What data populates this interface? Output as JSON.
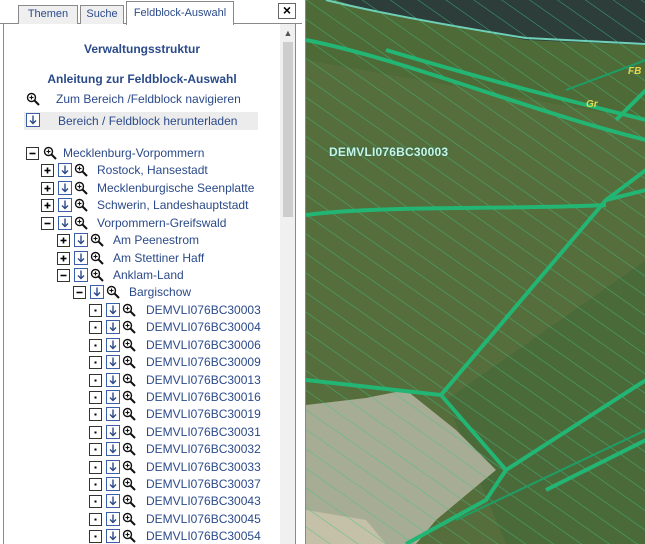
{
  "tabs": [
    {
      "label": "Themen",
      "active": false
    },
    {
      "label": "Suche",
      "active": false
    },
    {
      "label": "Feldblock-Auswahl",
      "active": true
    }
  ],
  "close_label": "×",
  "heading": "Verwaltungsstruktur",
  "anleitung": "Anleitung zur Feldblock-Auswahl",
  "actions": {
    "navigate": "Zum Bereich /Feldblock navigieren",
    "download": "Bereich / Feldblock herunterladen"
  },
  "tree": {
    "root": "Mecklenburg-Vorpommern",
    "districts": [
      "Rostock, Hansestadt",
      "Mecklenburgische Seenplatte",
      "Schwerin, Landeshauptstadt",
      "Vorpommern-Greifswald"
    ],
    "amts": [
      "Am Peenestrom",
      "Am Stettiner Haff",
      "Anklam-Land"
    ],
    "gemeinde": "Bargischow",
    "fieldblocks": [
      "DEMVLI076BC30003",
      "DEMVLI076BC30004",
      "DEMVLI076BC30006",
      "DEMVLI076BC30009",
      "DEMVLI076BC30013",
      "DEMVLI076BC30016",
      "DEMVLI076BC30019",
      "DEMVLI076BC30031",
      "DEMVLI076BC30032",
      "DEMVLI076BC30033",
      "DEMVLI076BC30037",
      "DEMVLI076BC30043",
      "DEMVLI076BC30045",
      "DEMVLI076BC30054"
    ]
  },
  "map": {
    "field_label": "DEMVLI076BC30003",
    "label_gr": "Gr",
    "label_fb": "FB",
    "colors": {
      "field_outline": "#22b573",
      "hatch": "#35b07a",
      "field_green": "#4f6b3a",
      "label_yellow": "#e6d84a"
    }
  }
}
